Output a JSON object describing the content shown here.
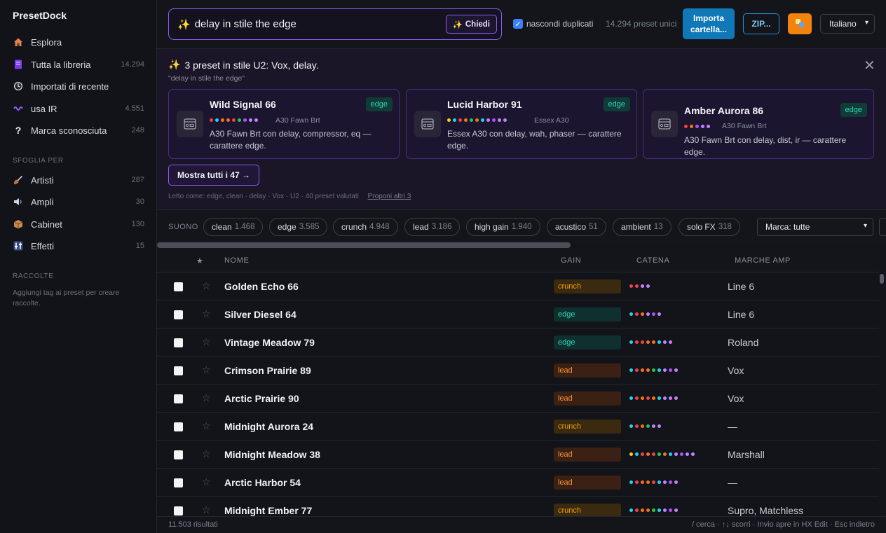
{
  "app": {
    "title": "PresetDock"
  },
  "sidebar": {
    "items": [
      {
        "label": "Esplora",
        "count": "",
        "icon": "house-icon"
      },
      {
        "label": "Tutta la libreria",
        "count": "14.294",
        "icon": "library-icon"
      },
      {
        "label": "Importati di recente",
        "count": "",
        "icon": "clock-icon"
      },
      {
        "label": "usa IR",
        "count": "4.551",
        "icon": "waveform-icon"
      },
      {
        "label": "Marca sconosciuta",
        "count": "248",
        "icon": "question-icon"
      }
    ],
    "browse_title": "SFOGLIA PER",
    "browse": [
      {
        "label": "Artisti",
        "count": "287",
        "icon": "guitar-icon"
      },
      {
        "label": "Ampli",
        "count": "30",
        "icon": "speaker-icon"
      },
      {
        "label": "Cabinet",
        "count": "130",
        "icon": "box-icon"
      },
      {
        "label": "Effetti",
        "count": "15",
        "icon": "sliders-icon"
      }
    ],
    "collections_title": "RACCOLTE",
    "collections_note": "Aggiungi tag ai preset per creare raccolte."
  },
  "topbar": {
    "search_value": "delay in stile the edge",
    "ask_label": "Chiedi",
    "hide_duplicates_label": "nascondi duplicati",
    "hide_duplicates_checked": true,
    "unique_count": "14.294 preset unici",
    "import_label_1": "Importa",
    "import_label_2": "cartella...",
    "zip_label": "ZIP...",
    "language": "Italiano"
  },
  "ai": {
    "title": "3 preset in stile U2: Vox, delay.",
    "query": "\"delay in stile the edge\"",
    "cards": [
      {
        "name": "Wild Signal 66",
        "tag": "edge",
        "amp": "A30 Fawn Brt",
        "desc": "A30 Fawn Brt con delay, compressor, eq — carattere edge.",
        "dots": [
          "#ef4444",
          "#22d3ee",
          "#f97316",
          "#f97316",
          "#ef4444",
          "#22c55e",
          "#a855f7",
          "#c084fc",
          "#c084fc"
        ]
      },
      {
        "name": "Lucid Harbor 91",
        "tag": "edge",
        "amp": "Essex A30",
        "desc": "Essex A30 con delay, wah, phaser — carattere edge.",
        "dots": [
          "#facc15",
          "#22d3ee",
          "#ef4444",
          "#f97316",
          "#22c55e",
          "#f97316",
          "#22d3ee",
          "#c084fc",
          "#a855f7",
          "#c084fc",
          "#c084fc"
        ]
      },
      {
        "name": "Amber Aurora 86",
        "tag": "edge",
        "amp": "A30 Fawn Brt",
        "desc": "A30 Fawn Brt con delay, dist, ir — carattere edge.",
        "dots": [
          "#ef4444",
          "#f97316",
          "#a855f7",
          "#c084fc",
          "#c084fc"
        ]
      }
    ],
    "show_all": "Mostra tutti i 47 →",
    "footer": "Letto come: edge, clean · delay · Vox · U2 · 40 preset valutati",
    "propose": "Proponi altri 3"
  },
  "filters": {
    "label": "SUONO",
    "pills": [
      {
        "label": "clean",
        "count": "1.468"
      },
      {
        "label": "edge",
        "count": "3.585"
      },
      {
        "label": "crunch",
        "count": "4.948"
      },
      {
        "label": "lead",
        "count": "3.186"
      },
      {
        "label": "high gain",
        "count": "1.940"
      },
      {
        "label": "acustico",
        "count": "51"
      },
      {
        "label": "ambient",
        "count": "13"
      },
      {
        "label": "solo FX",
        "count": "318"
      }
    ],
    "brand_select": "Marca: tutte"
  },
  "table": {
    "headers": {
      "star": "★",
      "name": "NOME",
      "gain": "GAIN",
      "chain": "CATENA",
      "amps": "MARCHE AMP"
    },
    "rows": [
      {
        "name": "Golden Echo 66",
        "gain": "crunch",
        "amp": "Line 6",
        "dots": [
          "#ef4444",
          "#ef4444",
          "#c084fc",
          "#c084fc"
        ]
      },
      {
        "name": "Silver Diesel 64",
        "gain": "edge",
        "amp": "Line 6",
        "dots": [
          "#22d3ee",
          "#ef4444",
          "#f97316",
          "#c084fc",
          "#a855f7",
          "#c084fc"
        ]
      },
      {
        "name": "Vintage Meadow 79",
        "gain": "edge",
        "amp": "Roland",
        "dots": [
          "#22d3ee",
          "#ef4444",
          "#ef4444",
          "#f97316",
          "#f97316",
          "#22d3ee",
          "#c084fc",
          "#c084fc"
        ]
      },
      {
        "name": "Crimson Prairie 89",
        "gain": "lead",
        "amp": "Vox",
        "dots": [
          "#22d3ee",
          "#ef4444",
          "#f97316",
          "#f97316",
          "#22c55e",
          "#22d3ee",
          "#c084fc",
          "#a855f7",
          "#c084fc"
        ]
      },
      {
        "name": "Arctic Prairie 90",
        "gain": "lead",
        "amp": "Vox",
        "dots": [
          "#22d3ee",
          "#ef4444",
          "#f97316",
          "#ef4444",
          "#f97316",
          "#22d3ee",
          "#c084fc",
          "#c084fc",
          "#c084fc"
        ]
      },
      {
        "name": "Midnight Aurora 24",
        "gain": "crunch",
        "amp": "—",
        "dots": [
          "#22d3ee",
          "#ef4444",
          "#f97316",
          "#22c55e",
          "#c084fc",
          "#c084fc"
        ]
      },
      {
        "name": "Midnight Meadow 38",
        "gain": "lead",
        "amp": "Marshall",
        "dots": [
          "#facc15",
          "#22d3ee",
          "#ef4444",
          "#f97316",
          "#ef4444",
          "#22c55e",
          "#f97316",
          "#22d3ee",
          "#c084fc",
          "#a855f7",
          "#c084fc",
          "#c084fc"
        ]
      },
      {
        "name": "Arctic Harbor 54",
        "gain": "lead",
        "amp": "—",
        "dots": [
          "#22d3ee",
          "#ef4444",
          "#f97316",
          "#f97316",
          "#ef4444",
          "#22d3ee",
          "#c084fc",
          "#a855f7",
          "#c084fc"
        ]
      },
      {
        "name": "Midnight Ember 77",
        "gain": "crunch",
        "amp": "Supro, Matchless",
        "dots": [
          "#22d3ee",
          "#ef4444",
          "#f97316",
          "#f97316",
          "#22c55e",
          "#22d3ee",
          "#c084fc",
          "#a855f7",
          "#c084fc"
        ]
      }
    ]
  },
  "status": {
    "results": "11.503 risultati",
    "hints": "/ cerca · ↑↓ scorri · Invio apre in HX Edit · Esc indietro"
  }
}
